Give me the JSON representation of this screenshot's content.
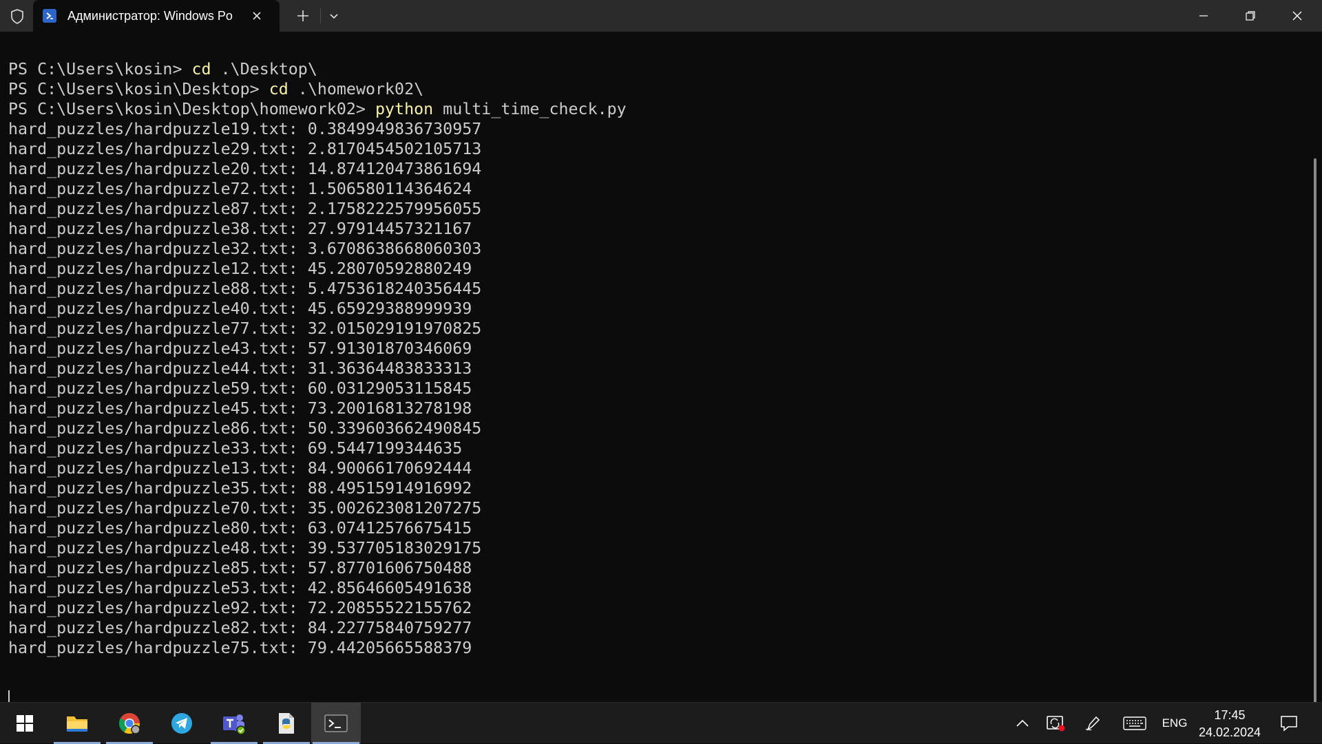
{
  "window": {
    "tab_title": "Администратор: Windows Po",
    "tab_icon": "powershell-icon"
  },
  "terminal": {
    "prompts": [
      {
        "prompt": "PS C:\\Users\\kosin> ",
        "command": "cd",
        "args": " .\\Desktop\\"
      },
      {
        "prompt": "PS C:\\Users\\kosin\\Desktop> ",
        "command": "cd",
        "args": " .\\homework02\\"
      },
      {
        "prompt": "PS C:\\Users\\kosin\\Desktop\\homework02> ",
        "command": "python",
        "args": " multi_time_check.py"
      }
    ],
    "output": [
      "hard_puzzles/hardpuzzle19.txt: 0.3849949836730957",
      "hard_puzzles/hardpuzzle29.txt: 2.8170454502105713",
      "hard_puzzles/hardpuzzle20.txt: 14.874120473861694",
      "hard_puzzles/hardpuzzle72.txt: 1.506580114364624",
      "hard_puzzles/hardpuzzle87.txt: 2.1758222579956055",
      "hard_puzzles/hardpuzzle38.txt: 27.97914457321167",
      "hard_puzzles/hardpuzzle32.txt: 3.6708638668060303",
      "hard_puzzles/hardpuzzle12.txt: 45.28070592880249",
      "hard_puzzles/hardpuzzle88.txt: 5.4753618240356445",
      "hard_puzzles/hardpuzzle40.txt: 45.65929388999939",
      "hard_puzzles/hardpuzzle77.txt: 32.015029191970825",
      "hard_puzzles/hardpuzzle43.txt: 57.91301870346069",
      "hard_puzzles/hardpuzzle44.txt: 31.36364483833313",
      "hard_puzzles/hardpuzzle59.txt: 60.03129053115845",
      "hard_puzzles/hardpuzzle45.txt: 73.20016813278198",
      "hard_puzzles/hardpuzzle86.txt: 50.339603662490845",
      "hard_puzzles/hardpuzzle33.txt: 69.5447199344635",
      "hard_puzzles/hardpuzzle13.txt: 84.90066170692444",
      "hard_puzzles/hardpuzzle35.txt: 88.49515914916992",
      "hard_puzzles/hardpuzzle70.txt: 35.002623081207275",
      "hard_puzzles/hardpuzzle80.txt: 63.07412576675415",
      "hard_puzzles/hardpuzzle48.txt: 39.537705183029175",
      "hard_puzzles/hardpuzzle85.txt: 57.87701606750488",
      "hard_puzzles/hardpuzzle53.txt: 42.85646605491638",
      "hard_puzzles/hardpuzzle92.txt: 72.20855522155762",
      "hard_puzzles/hardpuzzle82.txt: 84.22775840759277",
      "hard_puzzles/hardpuzzle75.txt: 79.44205665588379"
    ]
  },
  "taskbar": {
    "apps": [
      {
        "name": "start-icon"
      },
      {
        "name": "file-explorer-icon"
      },
      {
        "name": "chrome-icon"
      },
      {
        "name": "telegram-icon"
      },
      {
        "name": "teams-icon"
      },
      {
        "name": "python-icon"
      },
      {
        "name": "terminal-icon"
      }
    ],
    "language": "ENG",
    "time": "17:45",
    "date": "24.02.2024"
  },
  "colors": {
    "terminal_bg": "#0c0c0c",
    "text": "#cccccc",
    "command": "#f9f1a5",
    "titlebar": "#2b2b2b",
    "taskbar": "#1c1c1c"
  }
}
